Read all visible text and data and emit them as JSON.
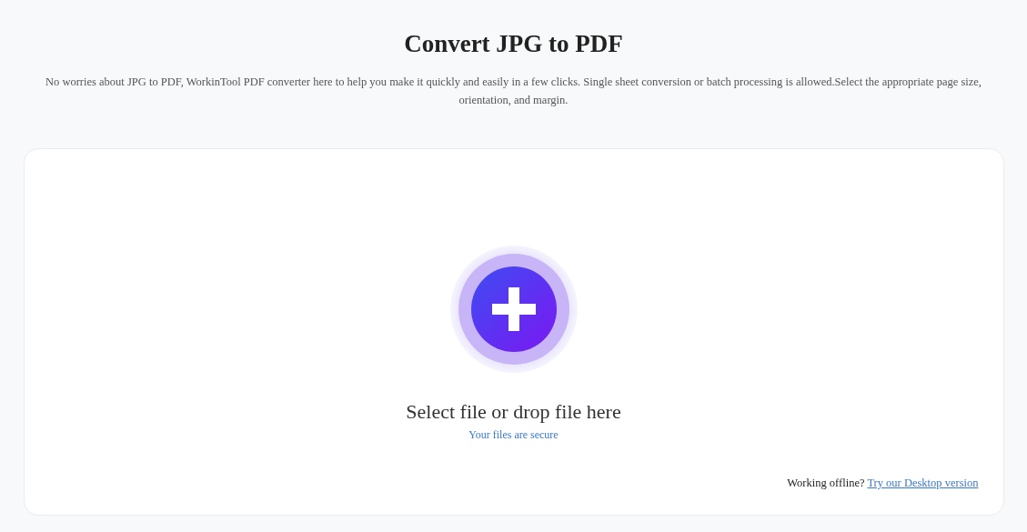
{
  "header": {
    "title": "Convert JPG to PDF",
    "description": "No worries about JPG to PDF, WorkinTool PDF converter here to help you make it quickly and easily in a few clicks. Single sheet conversion or batch processing is allowed.Select the appropriate page size, orientation, and margin."
  },
  "upload": {
    "prompt": "Select file or drop file here",
    "security_note": "Your files are secure"
  },
  "offline": {
    "text": "Working offline?",
    "link": "Try our Desktop version"
  }
}
